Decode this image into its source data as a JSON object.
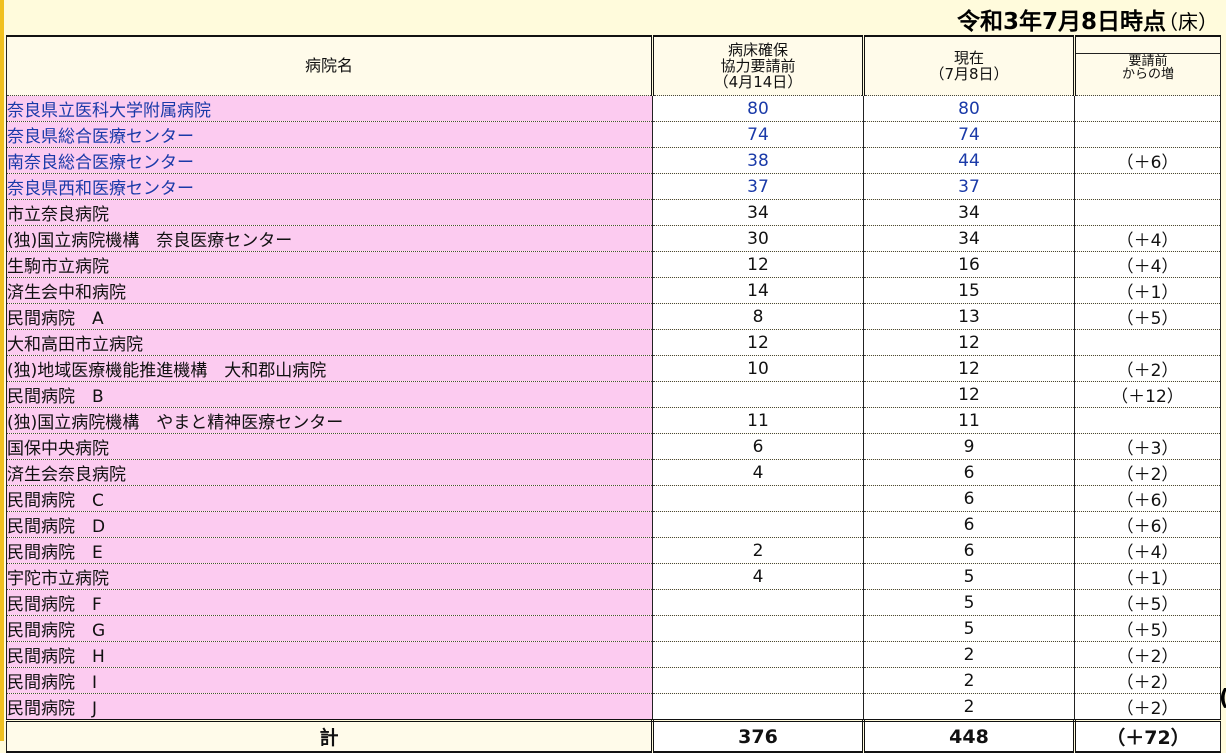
{
  "as_of": "令和3年7月8日時点",
  "unit": "（床）",
  "headers": {
    "hospital": "病院名",
    "before_l1": "病床確保",
    "before_l2": "協力要請前",
    "before_l3": "（4月14日）",
    "current_l1": "現在",
    "current_l2": "（7月8日）",
    "increase_l1": "要請前",
    "increase_l2": "からの増"
  },
  "rows": [
    {
      "name": "奈良県立医科大学附属病院",
      "before": "80",
      "current": "80",
      "increase": ""
    },
    {
      "name": "奈良県総合医療センター",
      "before": "74",
      "current": "74",
      "increase": ""
    },
    {
      "name": "南奈良総合医療センター",
      "before": "38",
      "current": "44",
      "increase": "（＋6）"
    },
    {
      "name": "奈良県西和医療センター",
      "before": "37",
      "current": "37",
      "increase": ""
    },
    {
      "name": "市立奈良病院",
      "before": "34",
      "current": "34",
      "increase": ""
    },
    {
      "name": "(独)国立病院機構　奈良医療センター",
      "before": "30",
      "current": "34",
      "increase": "（＋4）"
    },
    {
      "name": "生駒市立病院",
      "before": "12",
      "current": "16",
      "increase": "（＋4）"
    },
    {
      "name": "済生会中和病院",
      "before": "14",
      "current": "15",
      "increase": "（＋1）"
    },
    {
      "name": "民間病院　A",
      "before": "8",
      "current": "13",
      "increase": "（＋5）"
    },
    {
      "name": "大和高田市立病院",
      "before": "12",
      "current": "12",
      "increase": ""
    },
    {
      "name": "(独)地域医療機能推進機構　大和郡山病院",
      "before": "10",
      "current": "12",
      "increase": "（＋2）"
    },
    {
      "name": "民間病院　B",
      "before": "",
      "current": "12",
      "increase": "（＋12）"
    },
    {
      "name": "(独)国立病院機構　やまと精神医療センター",
      "before": "11",
      "current": "11",
      "increase": ""
    },
    {
      "name": "国保中央病院",
      "before": "6",
      "current": "9",
      "increase": "（＋3）"
    },
    {
      "name": "済生会奈良病院",
      "before": "4",
      "current": "6",
      "increase": "（＋2）"
    },
    {
      "name": "民間病院　C",
      "before": "",
      "current": "6",
      "increase": "（＋6）"
    },
    {
      "name": "民間病院　D",
      "before": "",
      "current": "6",
      "increase": "（＋6）"
    },
    {
      "name": "民間病院　E",
      "before": "2",
      "current": "6",
      "increase": "（＋4）"
    },
    {
      "name": "宇陀市立病院",
      "before": "4",
      "current": "5",
      "increase": "（＋1）"
    },
    {
      "name": "民間病院　F",
      "before": "",
      "current": "5",
      "increase": "（＋5）"
    },
    {
      "name": "民間病院　G",
      "before": "",
      "current": "5",
      "increase": "（＋5）"
    },
    {
      "name": "民間病院　H",
      "before": "",
      "current": "2",
      "increase": "（＋2）"
    },
    {
      "name": "民間病院　I",
      "before": "",
      "current": "2",
      "increase": "（＋2）"
    },
    {
      "name": "民間病院　J",
      "before": "",
      "current": "2",
      "increase": "（＋2）"
    }
  ],
  "total": {
    "label": "計",
    "before": "376",
    "current": "448",
    "increase": "（＋72）"
  },
  "colors": {
    "name_bg": "#fccbf0",
    "prefectural_text": "#1a3aa8",
    "page_bg": "#fffbdc"
  }
}
